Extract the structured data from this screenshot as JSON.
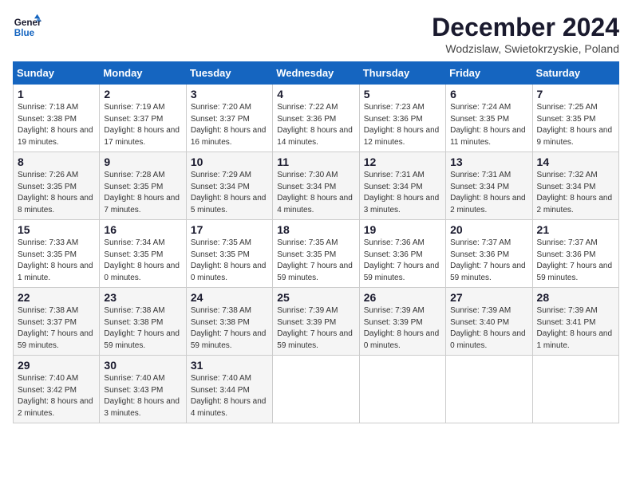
{
  "logo": {
    "line1": "General",
    "line2": "Blue"
  },
  "title": "December 2024",
  "location": "Wodzislaw, Swietokrzyskie, Poland",
  "days_of_week": [
    "Sunday",
    "Monday",
    "Tuesday",
    "Wednesday",
    "Thursday",
    "Friday",
    "Saturday"
  ],
  "weeks": [
    [
      {
        "day": "1",
        "sunrise": "7:18 AM",
        "sunset": "3:38 PM",
        "daylight": "8 hours and 19 minutes."
      },
      {
        "day": "2",
        "sunrise": "7:19 AM",
        "sunset": "3:37 PM",
        "daylight": "8 hours and 17 minutes."
      },
      {
        "day": "3",
        "sunrise": "7:20 AM",
        "sunset": "3:37 PM",
        "daylight": "8 hours and 16 minutes."
      },
      {
        "day": "4",
        "sunrise": "7:22 AM",
        "sunset": "3:36 PM",
        "daylight": "8 hours and 14 minutes."
      },
      {
        "day": "5",
        "sunrise": "7:23 AM",
        "sunset": "3:36 PM",
        "daylight": "8 hours and 12 minutes."
      },
      {
        "day": "6",
        "sunrise": "7:24 AM",
        "sunset": "3:35 PM",
        "daylight": "8 hours and 11 minutes."
      },
      {
        "day": "7",
        "sunrise": "7:25 AM",
        "sunset": "3:35 PM",
        "daylight": "8 hours and 9 minutes."
      }
    ],
    [
      {
        "day": "8",
        "sunrise": "7:26 AM",
        "sunset": "3:35 PM",
        "daylight": "8 hours and 8 minutes."
      },
      {
        "day": "9",
        "sunrise": "7:28 AM",
        "sunset": "3:35 PM",
        "daylight": "8 hours and 7 minutes."
      },
      {
        "day": "10",
        "sunrise": "7:29 AM",
        "sunset": "3:34 PM",
        "daylight": "8 hours and 5 minutes."
      },
      {
        "day": "11",
        "sunrise": "7:30 AM",
        "sunset": "3:34 PM",
        "daylight": "8 hours and 4 minutes."
      },
      {
        "day": "12",
        "sunrise": "7:31 AM",
        "sunset": "3:34 PM",
        "daylight": "8 hours and 3 minutes."
      },
      {
        "day": "13",
        "sunrise": "7:31 AM",
        "sunset": "3:34 PM",
        "daylight": "8 hours and 2 minutes."
      },
      {
        "day": "14",
        "sunrise": "7:32 AM",
        "sunset": "3:34 PM",
        "daylight": "8 hours and 2 minutes."
      }
    ],
    [
      {
        "day": "15",
        "sunrise": "7:33 AM",
        "sunset": "3:35 PM",
        "daylight": "8 hours and 1 minute."
      },
      {
        "day": "16",
        "sunrise": "7:34 AM",
        "sunset": "3:35 PM",
        "daylight": "8 hours and 0 minutes."
      },
      {
        "day": "17",
        "sunrise": "7:35 AM",
        "sunset": "3:35 PM",
        "daylight": "8 hours and 0 minutes."
      },
      {
        "day": "18",
        "sunrise": "7:35 AM",
        "sunset": "3:35 PM",
        "daylight": "7 hours and 59 minutes."
      },
      {
        "day": "19",
        "sunrise": "7:36 AM",
        "sunset": "3:36 PM",
        "daylight": "7 hours and 59 minutes."
      },
      {
        "day": "20",
        "sunrise": "7:37 AM",
        "sunset": "3:36 PM",
        "daylight": "7 hours and 59 minutes."
      },
      {
        "day": "21",
        "sunrise": "7:37 AM",
        "sunset": "3:36 PM",
        "daylight": "7 hours and 59 minutes."
      }
    ],
    [
      {
        "day": "22",
        "sunrise": "7:38 AM",
        "sunset": "3:37 PM",
        "daylight": "7 hours and 59 minutes."
      },
      {
        "day": "23",
        "sunrise": "7:38 AM",
        "sunset": "3:38 PM",
        "daylight": "7 hours and 59 minutes."
      },
      {
        "day": "24",
        "sunrise": "7:38 AM",
        "sunset": "3:38 PM",
        "daylight": "7 hours and 59 minutes."
      },
      {
        "day": "25",
        "sunrise": "7:39 AM",
        "sunset": "3:39 PM",
        "daylight": "7 hours and 59 minutes."
      },
      {
        "day": "26",
        "sunrise": "7:39 AM",
        "sunset": "3:39 PM",
        "daylight": "8 hours and 0 minutes."
      },
      {
        "day": "27",
        "sunrise": "7:39 AM",
        "sunset": "3:40 PM",
        "daylight": "8 hours and 0 minutes."
      },
      {
        "day": "28",
        "sunrise": "7:39 AM",
        "sunset": "3:41 PM",
        "daylight": "8 hours and 1 minute."
      }
    ],
    [
      {
        "day": "29",
        "sunrise": "7:40 AM",
        "sunset": "3:42 PM",
        "daylight": "8 hours and 2 minutes."
      },
      {
        "day": "30",
        "sunrise": "7:40 AM",
        "sunset": "3:43 PM",
        "daylight": "8 hours and 3 minutes."
      },
      {
        "day": "31",
        "sunrise": "7:40 AM",
        "sunset": "3:44 PM",
        "daylight": "8 hours and 4 minutes."
      },
      null,
      null,
      null,
      null
    ]
  ]
}
